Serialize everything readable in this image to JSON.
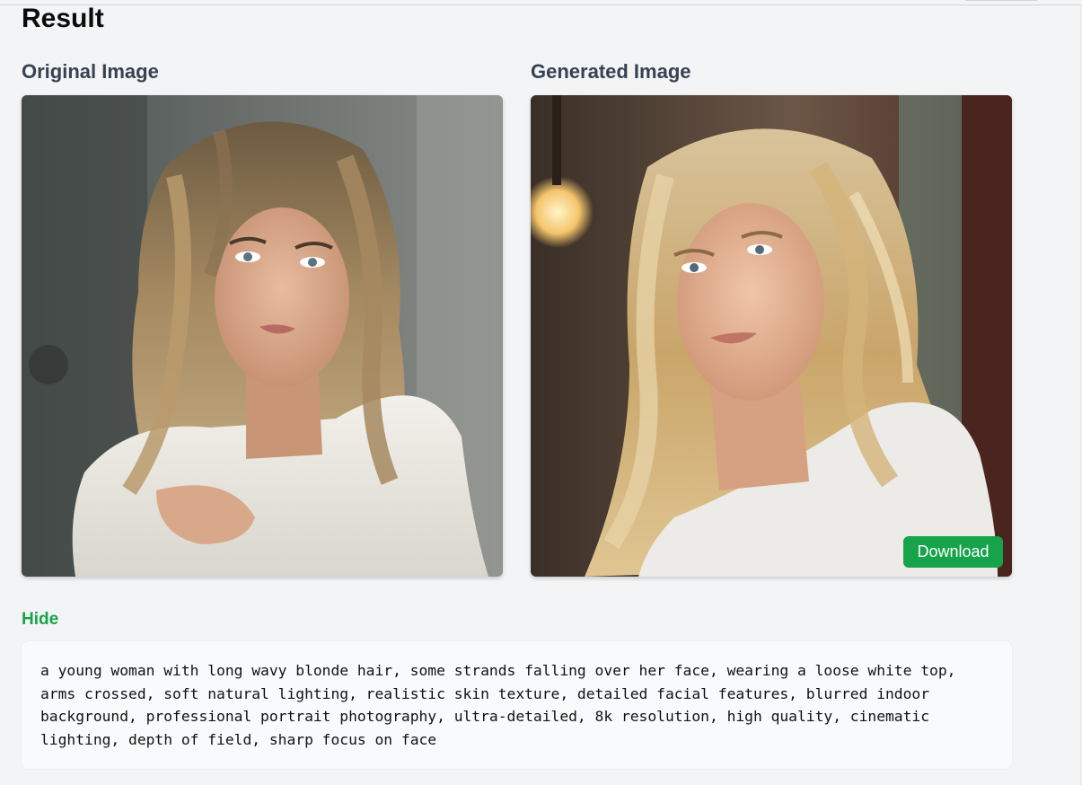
{
  "page": {
    "title": "Result"
  },
  "original": {
    "heading": "Original Image",
    "image_alt": "original-portrait-photo"
  },
  "generated": {
    "heading": "Generated Image",
    "image_alt": "generated-portrait-photo",
    "download_label": "Download"
  },
  "prompt": {
    "toggle_label": "Hide",
    "text": "a young woman with long wavy blonde hair, some strands falling over her face, wearing a loose white top, arms crossed, soft natural lighting, realistic skin texture, detailed facial features, blurred indoor background, professional portrait photography, ultra-detailed, 8k resolution, high quality, cinematic lighting, depth of field, sharp focus on face"
  },
  "colors": {
    "accent": "#16a34a",
    "page_bg": "#f3f4f6",
    "prompt_bg": "#f9fafb"
  }
}
